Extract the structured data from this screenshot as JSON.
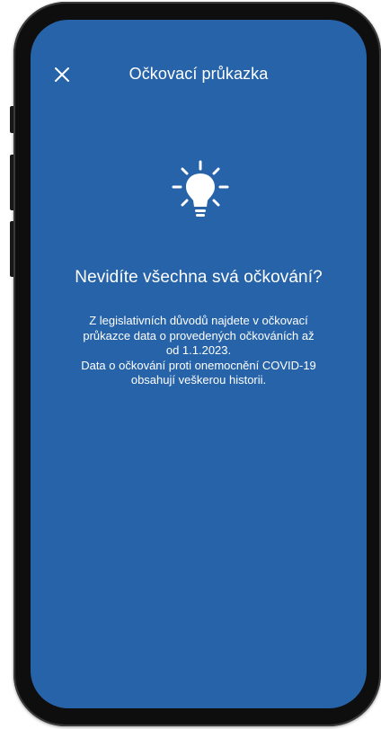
{
  "header": {
    "title": "Očkovací průkazka",
    "close_icon": "close-icon"
  },
  "main": {
    "icon": "lightbulb-icon",
    "heading": "Nevidíte všechna svá očkování?",
    "paragraph_lines": [
      "Z legislativních důvodů najdete v očkovací",
      "průkazce data o provedených očkováních až",
      "od 1.1.2023.",
      "Data o očkování proti onemocnění COVID-19",
      "obsahují veškerou historii."
    ]
  },
  "colors": {
    "background": "#2763a8",
    "text": "#ffffff",
    "frame": "#0e0e0e"
  }
}
